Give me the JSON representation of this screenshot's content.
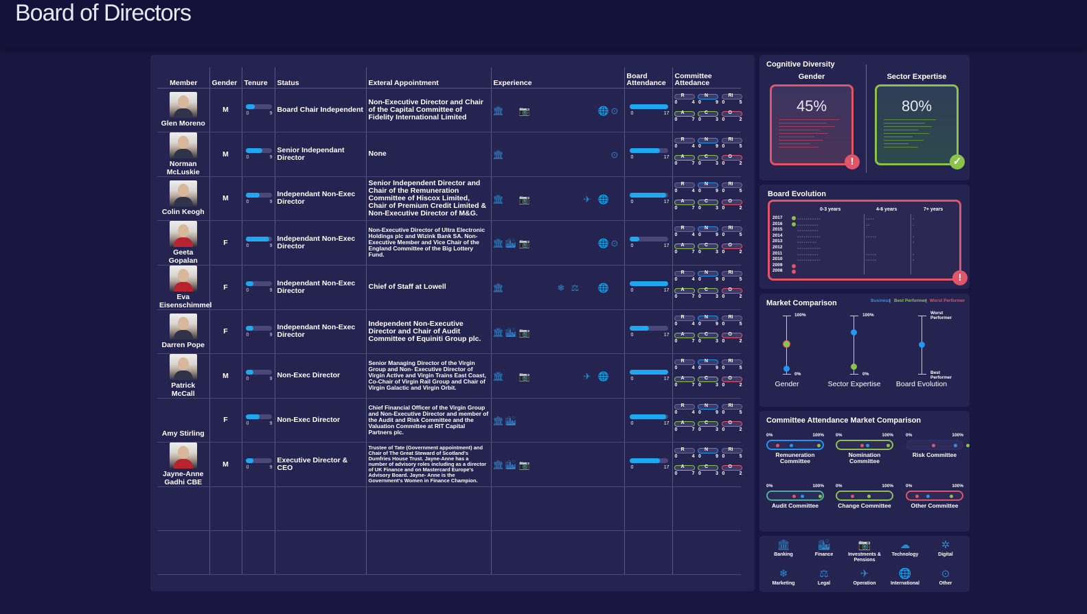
{
  "page": {
    "title": "Board of Directors"
  },
  "table": {
    "headers": {
      "member": "Member",
      "gender": "Gender",
      "tenure": "Tenure",
      "status": "Status",
      "external": "Exteral Appointment",
      "experience": "Experience",
      "board_attendance": "Board Attendance",
      "committee_attendance": "Committee Attedance"
    },
    "tenure_scale": {
      "min": "0",
      "max": "9"
    },
    "attendance_scale": {
      "min": "0",
      "max": "17"
    },
    "committee_labels": {
      "r": "R",
      "n": "N",
      "ri": "RI",
      "a": "A",
      "c": "C",
      "o": "O"
    },
    "committee_numbers": {
      "r": [
        "0",
        "4"
      ],
      "n": [
        "0",
        "9"
      ],
      "ri": [
        "0",
        "5"
      ],
      "a": [
        "0",
        "7"
      ],
      "c": [
        "0",
        "3"
      ],
      "o": [
        "0",
        "2"
      ]
    },
    "rows": [
      {
        "name": "Glen Moreno",
        "gender": "M",
        "status": "Board Chair Independent",
        "appointment": "Non-Executive Director and Chair of the Capital Committee of Fidelity International Limited",
        "tenure": 0.35,
        "attendance": 1.0,
        "female": false,
        "photo": true,
        "size": "",
        "icons": [
          "banking-icon",
          "investments-icon",
          "international-icon",
          "other-icon"
        ]
      },
      {
        "name": "Norman McLuskie",
        "gender": "M",
        "status": "Senior Independant Director",
        "appointment": "None",
        "tenure": 0.65,
        "attendance": 0.8,
        "female": false,
        "photo": true,
        "size": "",
        "icons": [
          "banking-icon",
          "other-icon"
        ]
      },
      {
        "name": "Colin Keogh",
        "gender": "M",
        "status": "Independant Non-Exec Director",
        "appointment": "Senior Independent Director and Chair of the Remuneration Committee of Hiscox Limited, Chair of Premium Credit Limited & Non-Executive Director of M&G.",
        "tenure": 0.55,
        "attendance": 0.95,
        "female": false,
        "photo": true,
        "size": "",
        "icons": [
          "banking-icon",
          "investments-icon",
          "operation-icon",
          "international-icon"
        ]
      },
      {
        "name": "Geeta Gopalan",
        "gender": "F",
        "status": "Independant Non-Exec Director",
        "appointment": "Non-Executive Director of Ultra Electronic Holdings plc and Wizink Bank SA. Non-Executive Member and Vice Chair of the England Committee of the Big Lottery Fund.",
        "tenure": 0.9,
        "attendance": 0.25,
        "female": true,
        "photo": true,
        "size": "sm",
        "icons": [
          "banking-icon",
          "finance-icon",
          "investments-icon",
          "international-icon",
          "other-icon"
        ]
      },
      {
        "name": "Eva Eisenschimmel",
        "gender": "F",
        "status": "Independant Non-Exec Director",
        "appointment": "Chief of Staff at Lowell",
        "tenure": 0.3,
        "attendance": 1.0,
        "female": true,
        "photo": true,
        "size": "",
        "icons": [
          "banking-icon",
          "marketing-icon",
          "legal-icon",
          "international-icon"
        ]
      },
      {
        "name": "Darren Pope",
        "gender": "F",
        "status": "Independant Non-Exec Director",
        "appointment": "Independent Non-Executive Director and Chair of Audit Committee of Equiniti Group plc.",
        "tenure": 0.3,
        "attendance": 0.5,
        "female": false,
        "photo": true,
        "size": "",
        "icons": [
          "banking-icon",
          "finance-icon",
          "investments-icon"
        ]
      },
      {
        "name": "Patrick McCall",
        "gender": "M",
        "status": "Non-Exec Director",
        "appointment": "Senior Managing Director of the Virgin Group and Non- Executive Director of Virgin Active and Virgin Trains East Coast, Co-Chair of Virgin Rail Group and Chair of Virgin Galactic and Virgin Orbit.",
        "tenure": 0.3,
        "attendance": 1.0,
        "female": false,
        "photo": true,
        "size": "sm",
        "icons": [
          "banking-icon",
          "investments-icon",
          "operation-icon",
          "international-icon"
        ]
      },
      {
        "name": "Amy Stirling",
        "gender": "F",
        "status": "Non-Exec Director",
        "appointment": "Chief Financial Officer of the Virgin Group and Non-Executive Director and member of the Audit and Risk Committee and the Valuation Committee at RIT Capital Partners plc.",
        "tenure": 0.55,
        "attendance": 0.95,
        "female": true,
        "photo": false,
        "size": "sm",
        "icons": [
          "banking-icon",
          "finance-icon"
        ]
      },
      {
        "name": "Jayne-Anne Gadhi CBE",
        "gender": "M",
        "status": "Executive Director & CEO",
        "appointment": "Trustee of Tate (Government appointment) and Chair of The Great Steward of Scotland's Dumfries House Trust. Jayne-Anne has a number of advisory roles including as a director of UK Finance and on Mastercard Europe's Advisory Board. Jayne- Anne is the Government's Women in Finance Champion.",
        "tenure": 0.3,
        "attendance": 0.8,
        "female": true,
        "photo": true,
        "size": "xs",
        "icons": [
          "banking-icon",
          "finance-icon",
          "investments-icon"
        ]
      }
    ]
  },
  "diversity": {
    "title": "Cognitive Diversity",
    "gender_label": "Gender",
    "gender_value": "45%",
    "gender_alert": "!",
    "sector_label": "Sector Expertise",
    "sector_value": "80%",
    "sector_ok": "✓"
  },
  "evolution": {
    "title": "Board Evolution",
    "headers": [
      "0-3 years",
      "4-6 years",
      "7+ years"
    ],
    "years": [
      "2017",
      "2016",
      "2015",
      "2014",
      "2013",
      "2012",
      "2011",
      "2010",
      "2009",
      "2008"
    ],
    "alert": "!"
  },
  "market": {
    "title": "Market Comparison",
    "legend": {
      "business": "Business",
      "best": "Best Performer",
      "worst": "Worst Performer",
      "sep": "|"
    },
    "colors": {
      "business": "#2196f3",
      "best": "#8bc34a",
      "worst": "#e05667"
    },
    "top_label": "100%",
    "bottom_label": "0%",
    "worst_label": "Worst Performer",
    "best_label": "Best Performer",
    "gender": "Gender",
    "sector": "Sector Expertise",
    "board": "Board Evolution"
  },
  "committee_market": {
    "title": "Committee Attendance Market Comparison",
    "min": "0%",
    "max": "100%",
    "committees": [
      {
        "name": "Remuneration Committee",
        "color": "#2196f3"
      },
      {
        "name": "Nomination Committee",
        "color": "#8bc34a"
      },
      {
        "name": "Risk Committee",
        "color": "#2f2c6a"
      },
      {
        "name": "Audit Committee",
        "color": "#4caf9a"
      },
      {
        "name": "Change Committee",
        "color": "#8bc34a"
      },
      {
        "name": "Other Committee",
        "color": "#e05667"
      }
    ]
  },
  "legend": {
    "items": [
      {
        "label": "Banking",
        "icon": "banking-icon"
      },
      {
        "label": "Finance",
        "icon": "finance-icon"
      },
      {
        "label": "Investments & Pensions",
        "icon": "investments-icon"
      },
      {
        "label": "Technology",
        "icon": "technology-icon"
      },
      {
        "label": "Digital",
        "icon": "digital-icon"
      },
      {
        "label": "Marketing",
        "icon": "marketing-icon"
      },
      {
        "label": "Legal",
        "icon": "legal-icon"
      },
      {
        "label": "Operation",
        "icon": "operation-icon"
      },
      {
        "label": "International",
        "icon": "international-icon"
      },
      {
        "label": "Other",
        "icon": "other-icon"
      }
    ]
  }
}
